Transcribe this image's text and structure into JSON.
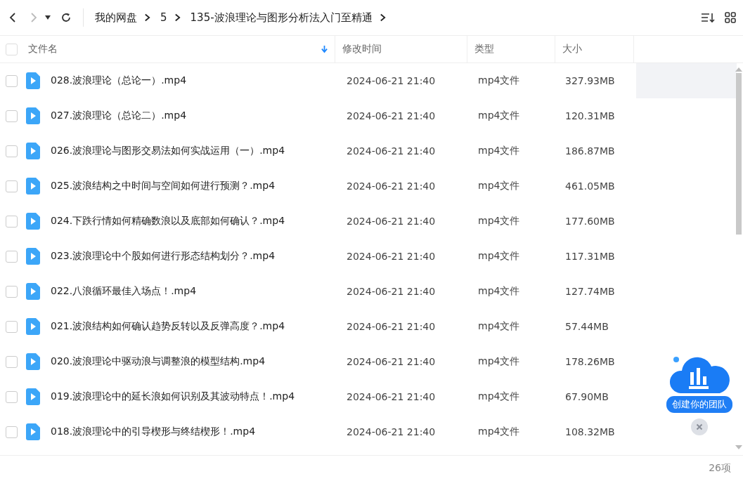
{
  "breadcrumb": [
    "我的网盘",
    "5",
    "135-波浪理论与图形分析法入门至精通"
  ],
  "columns": [
    {
      "label": "文件名",
      "sorted": true
    },
    {
      "label": "修改时间",
      "sorted": false
    },
    {
      "label": "类型",
      "sorted": false
    },
    {
      "label": "大小",
      "sorted": false
    }
  ],
  "rows": [
    {
      "name": "028.波浪理论（总论一）.mp4",
      "modified": "2024-06-21 21:40",
      "type": "mp4文件",
      "size": "327.93MB",
      "checked": false,
      "hovered": true
    },
    {
      "name": "027.波浪理论（总论二）.mp4",
      "modified": "2024-06-21 21:40",
      "type": "mp4文件",
      "size": "120.31MB",
      "checked": false,
      "hovered": false
    },
    {
      "name": "026.波浪理论与图形交易法如何实战运用（一）.mp4",
      "modified": "2024-06-21 21:40",
      "type": "mp4文件",
      "size": "186.87MB",
      "checked": false,
      "hovered": false
    },
    {
      "name": "025.波浪结构之中时间与空间如何进行预测？.mp4",
      "modified": "2024-06-21 21:40",
      "type": "mp4文件",
      "size": "461.05MB",
      "checked": false,
      "hovered": false
    },
    {
      "name": "024.下跌行情如何精确数浪以及底部如何确认？.mp4",
      "modified": "2024-06-21 21:40",
      "type": "mp4文件",
      "size": "177.60MB",
      "checked": false,
      "hovered": false
    },
    {
      "name": "023.波浪理论中个股如何进行形态结构划分？.mp4",
      "modified": "2024-06-21 21:40",
      "type": "mp4文件",
      "size": "117.31MB",
      "checked": false,
      "hovered": false
    },
    {
      "name": "022.八浪循环最佳入场点！.mp4",
      "modified": "2024-06-21 21:40",
      "type": "mp4文件",
      "size": "127.74MB",
      "checked": false,
      "hovered": false
    },
    {
      "name": "021.波浪结构如何确认趋势反转以及反弹高度？.mp4",
      "modified": "2024-06-21 21:40",
      "type": "mp4文件",
      "size": "57.44MB",
      "checked": false,
      "hovered": false
    },
    {
      "name": "020.波浪理论中驱动浪与调整浪的模型结构.mp4",
      "modified": "2024-06-21 21:40",
      "type": "mp4文件",
      "size": "178.26MB",
      "checked": false,
      "hovered": false
    },
    {
      "name": "019.波浪理论中的延长浪如何识别及其波动特点！.mp4",
      "modified": "2024-06-21 21:40",
      "type": "mp4文件",
      "size": "67.90MB",
      "checked": false,
      "hovered": false
    },
    {
      "name": "018.波浪理论中的引导楔形与终结楔形！.mp4",
      "modified": "2024-06-21 21:40",
      "type": "mp4文件",
      "size": "108.32MB",
      "checked": false,
      "hovered": false
    }
  ],
  "select_all": {
    "checked": false
  },
  "promo": {
    "label": "创建你的团队"
  },
  "status_bar": {
    "count": "26项"
  }
}
